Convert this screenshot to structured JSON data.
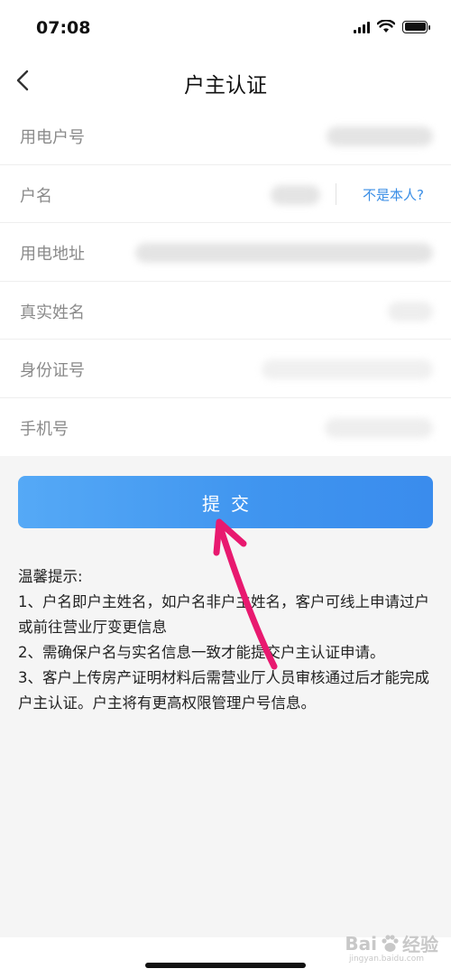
{
  "status_bar": {
    "time": "07:08"
  },
  "nav": {
    "title": "户主认证"
  },
  "form": {
    "rows": [
      {
        "label": "用电户号"
      },
      {
        "label": "户名",
        "action": "不是本人?"
      },
      {
        "label": "用电地址"
      },
      {
        "label": "真实姓名"
      },
      {
        "label": "身份证号"
      },
      {
        "label": "手机号"
      }
    ]
  },
  "submit": {
    "label": "提交"
  },
  "tips": {
    "title": "温馨提示:",
    "lines": [
      "1、户名即户主姓名，如户名非户主姓名，客户可线上申请过户或前往营业厅变更信息",
      "2、需确保户名与实名信息一致才能提交户主认证申请。",
      "3、客户上传房产证明材料后需营业厅人员审核通过后才能完成户主认证。户主将有更高权限管理户号信息。"
    ]
  },
  "watermark": {
    "brand": "Bai",
    "brand_suffix": "经验",
    "domain": "jingyan.baidu.com"
  },
  "colors": {
    "primary": "#3f94ef",
    "link": "#3a8ee6",
    "arrow": "#e8196f"
  }
}
